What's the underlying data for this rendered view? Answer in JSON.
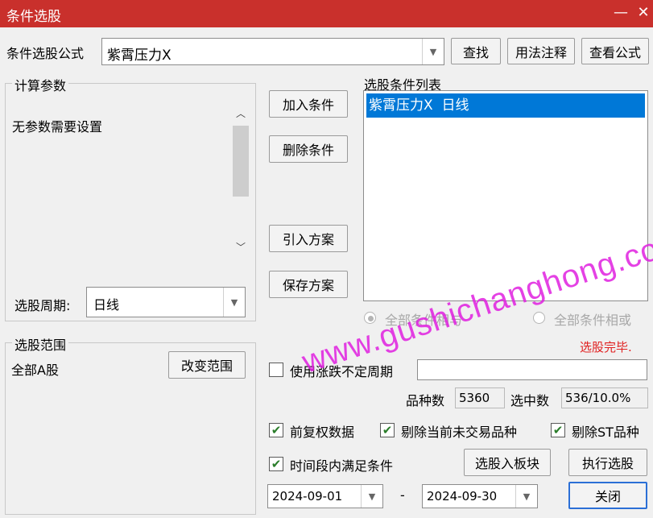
{
  "window": {
    "title": "条件选股",
    "minimize": "—",
    "close": "✕"
  },
  "formula": {
    "label": "条件选股公式",
    "value": "紫霄压力X"
  },
  "buttons": {
    "find": "查找",
    "usage": "用法注释",
    "view": "查看公式",
    "add": "加入条件",
    "delete": "删除条件",
    "import": "引入方案",
    "save": "保存方案",
    "change_range": "改变范围",
    "to_block": "选股入板块",
    "execute": "执行选股",
    "close": "关闭"
  },
  "params": {
    "legend": "计算参数",
    "text": "无参数需要设置"
  },
  "period": {
    "label": "选股周期:",
    "value": "日线"
  },
  "conditions": {
    "legend": "选股条件列表",
    "items": [
      "紫霄压力X  日线"
    ]
  },
  "logic": {
    "and_label": "全部条件相与",
    "or_label": "全部条件相或"
  },
  "status": {
    "text": "选股完毕.",
    "color": "#e02020"
  },
  "range": {
    "legend": "选股范围",
    "value": "全部A股"
  },
  "options": {
    "variable_period_label": "使用涨跌不定周期",
    "variable_period_value": "",
    "count_label": "品种数",
    "count_value": "5360",
    "selected_label": "选中数",
    "selected_value": "536/10.0%",
    "forward_adjust": {
      "label": "前复权数据",
      "checked": true
    },
    "exclude_untraded": {
      "label": "剔除当前未交易品种",
      "checked": true
    },
    "exclude_st": {
      "label": "剔除ST品种",
      "checked": true
    },
    "time_range": {
      "label": "时间段内满足条件",
      "checked": true
    }
  },
  "dates": {
    "start": "2024-09-01",
    "separator": "-",
    "end": "2024-09-30"
  },
  "watermark": {
    "text": "www.gushichanghong.com"
  },
  "icons": {
    "scroll_up": "︿",
    "scroll_down": "﹀",
    "dropdown": "▼",
    "check": "✔"
  }
}
